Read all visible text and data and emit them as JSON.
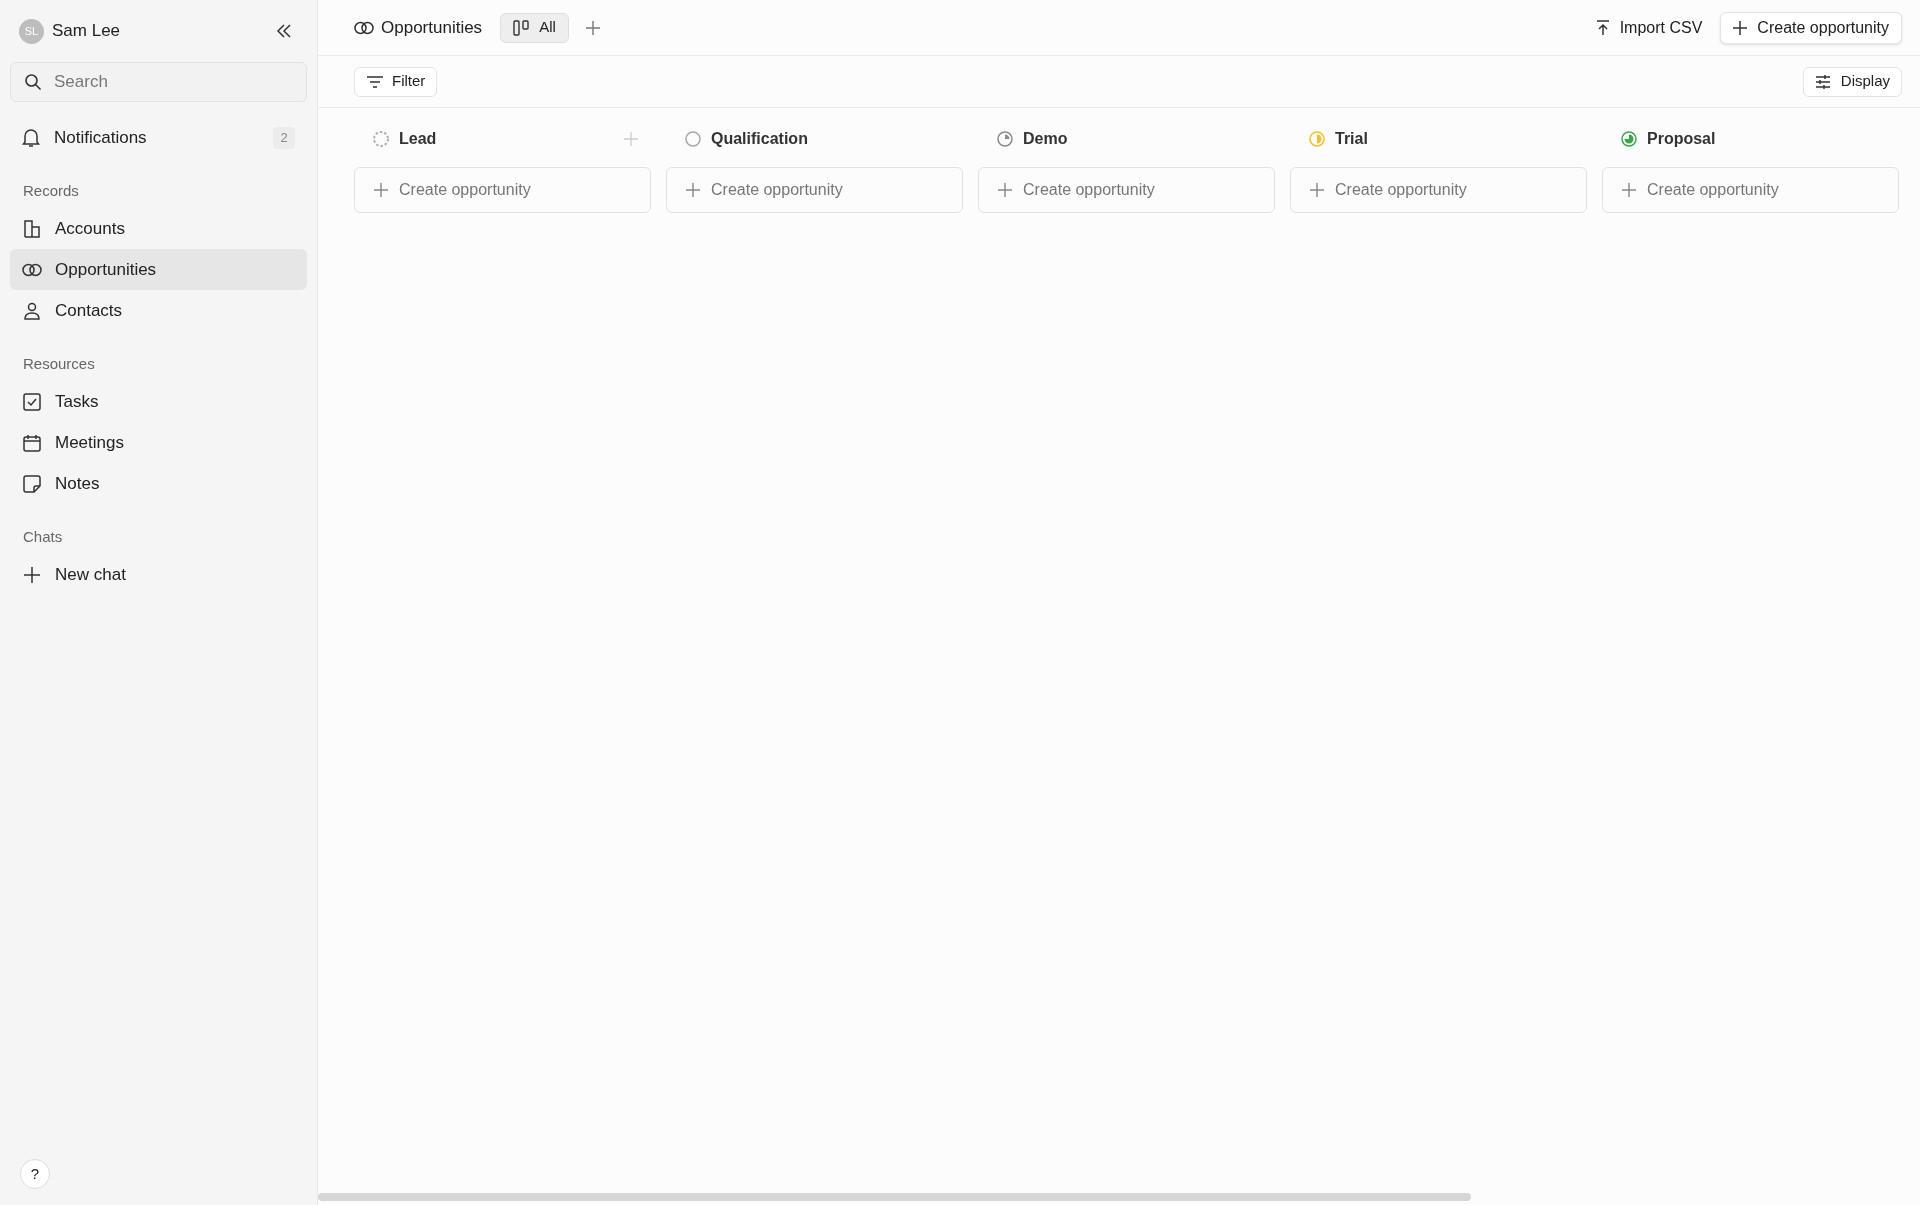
{
  "user": {
    "initials": "SL",
    "name": "Sam Lee"
  },
  "search": {
    "placeholder": "Search"
  },
  "notifications": {
    "label": "Notifications",
    "count": "2"
  },
  "sections": [
    {
      "title": "Records",
      "items": [
        {
          "label": "Accounts",
          "selected": false
        },
        {
          "label": "Opportunities",
          "selected": true
        },
        {
          "label": "Contacts",
          "selected": false
        }
      ]
    },
    {
      "title": "Resources",
      "items": [
        {
          "label": "Tasks",
          "selected": false
        },
        {
          "label": "Meetings",
          "selected": false
        },
        {
          "label": "Notes",
          "selected": false
        }
      ]
    },
    {
      "title": "Chats",
      "items": [
        {
          "label": "New chat",
          "selected": false
        }
      ]
    }
  ],
  "help": "?",
  "header": {
    "title": "Opportunities",
    "views": [
      {
        "label": "All",
        "selected": true
      }
    ]
  },
  "actions": {
    "import": "Import CSV",
    "create": "Create opportunity"
  },
  "filter": "Filter",
  "display": "Display",
  "columns": [
    {
      "name": "Lead",
      "kind": "dashed",
      "color": "#b0b0b0",
      "show_add": true,
      "card": "Create opportunity"
    },
    {
      "name": "Qualification",
      "kind": "empty",
      "color": "#a8a8a8",
      "show_add": false,
      "card": "Create opportunity"
    },
    {
      "name": "Demo",
      "kind": "quarter",
      "color": "#8a8a8a",
      "show_add": false,
      "card": "Create opportunity"
    },
    {
      "name": "Trial",
      "kind": "half",
      "color": "#f0c030",
      "show_add": false,
      "card": "Create opportunity"
    },
    {
      "name": "Proposal",
      "kind": "most",
      "color": "#3fa34d",
      "show_add": false,
      "card": "Create opportunity"
    }
  ]
}
